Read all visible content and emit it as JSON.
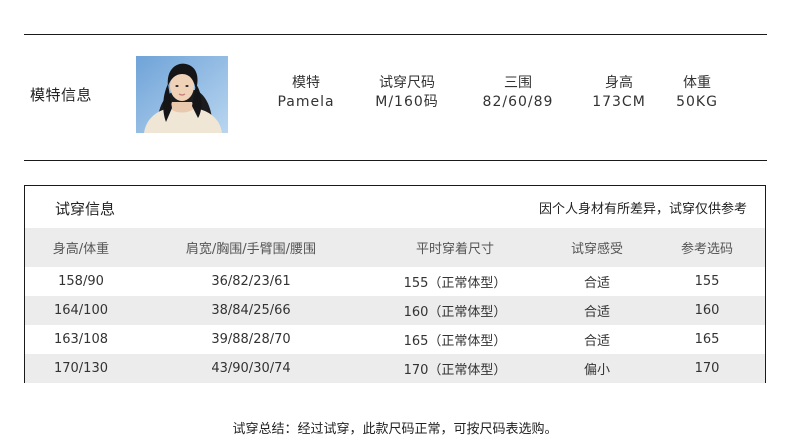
{
  "model": {
    "section_label": "模特信息",
    "photo_icon": "model-portrait-photo",
    "columns": [
      {
        "label": "模特",
        "value": "Pamela"
      },
      {
        "label": "试穿尺码",
        "value": "M/160码"
      },
      {
        "label": "三围",
        "value": "82/60/89"
      },
      {
        "label": "身高",
        "value": "173CM"
      },
      {
        "label": "体重",
        "value": "50KG"
      }
    ]
  },
  "fitting": {
    "title": "试穿信息",
    "note": "因个人身材有所差异，试穿仅供参考",
    "headers": [
      "身高/体重",
      "肩宽/胸围/手臂围/腰围",
      "平时穿着尺寸",
      "试穿感受",
      "参考选码"
    ],
    "rows": [
      [
        "158/90",
        "36/82/23/61",
        "155（正常体型）",
        "合适",
        "155"
      ],
      [
        "164/100",
        "38/84/25/66",
        "160（正常体型）",
        "合适",
        "160"
      ],
      [
        "163/108",
        "39/88/28/70",
        "165（正常体型）",
        "合适",
        "165"
      ],
      [
        "170/130",
        "43/90/30/74",
        "170（正常体型）",
        "偏小",
        "170"
      ]
    ]
  },
  "summary": "试穿总结：经过试穿，此款尺码正常，可按尺码表选购。",
  "colors": {
    "line": "#1a1a1a",
    "row_shade": "#ececec",
    "text": "#222222"
  }
}
